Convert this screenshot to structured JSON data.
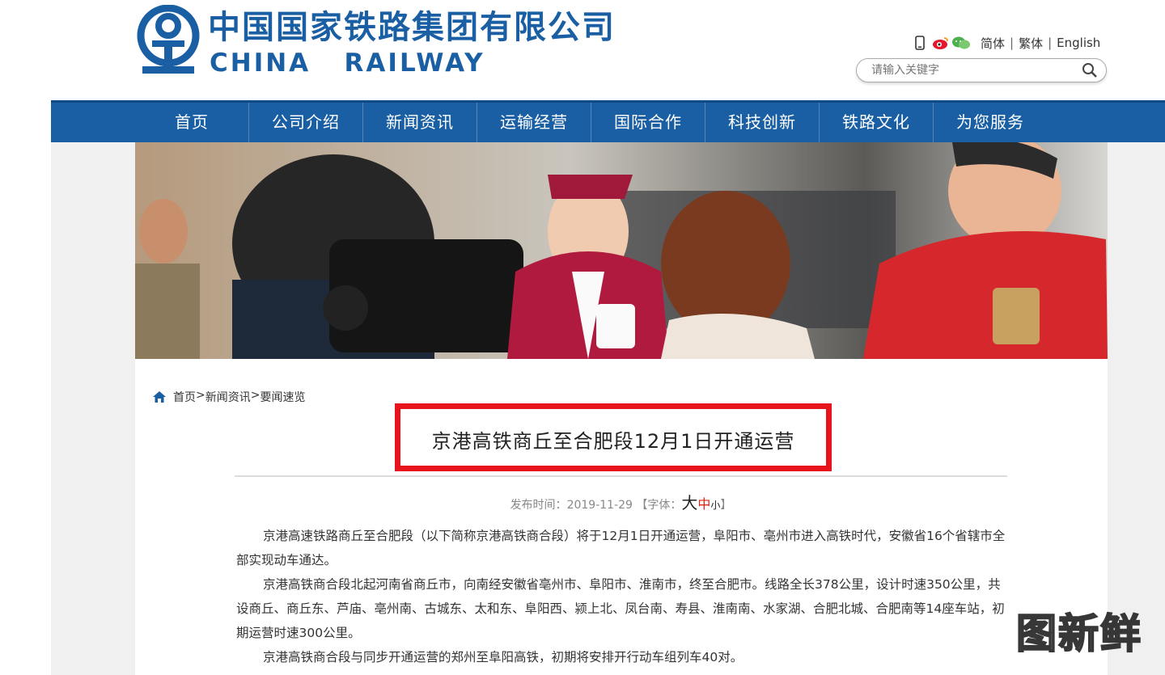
{
  "header": {
    "logo_cn": "中国国家铁路集团有限公司",
    "logo_en": "CHINA   RAILWAY",
    "icons": [
      "mobile-icon",
      "weibo-icon",
      "wechat-icon"
    ],
    "lang_simplified": "简体",
    "lang_traditional": "繁体",
    "lang_english": "English",
    "sep": "|",
    "search_placeholder": "请输入关键字"
  },
  "nav": {
    "items": [
      "首页",
      "公司介绍",
      "新闻资讯",
      "运输经营",
      "国际合作",
      "科技创新",
      "铁路文化",
      "为您服务"
    ]
  },
  "breadcrumb": {
    "home": "首页",
    "gt": ">",
    "news": "新闻资讯",
    "current": "要闻速览"
  },
  "article": {
    "title": "京港高铁商丘至合肥段12月1日开通运营",
    "publish_label": "发布时间：",
    "publish_date": "2019-11-29",
    "font_label_open": "【字体：",
    "font_large": "大",
    "font_medium": "中",
    "font_small": "小",
    "font_label_close": "】",
    "paragraphs": [
      "京港高速铁路商丘至合肥段（以下简称京港高铁商合段）将于12月1日开通运营，阜阳市、亳州市进入高铁时代，安徽省16个省辖市全部实现动车通达。",
      "京港高铁商合段北起河南省商丘市，向南经安徽省亳州市、阜阳市、淮南市，终至合肥市。线路全长378公里，设计时速350公里，共设商丘、商丘东、芦庙、亳州南、古城东、太和东、阜阳西、颍上北、凤台南、寿县、淮南南、水家湖、合肥北城、合肥南等14座车站，初期运营时速300公里。",
      "京港高铁商合段与同步开通运营的郑州至阜阳高铁，初期将安排开行动车组列车40对。"
    ]
  },
  "watermark": "图新鲜",
  "colors": {
    "brand_blue": "#1a5fa3",
    "highlight_red": "#e8141c"
  }
}
